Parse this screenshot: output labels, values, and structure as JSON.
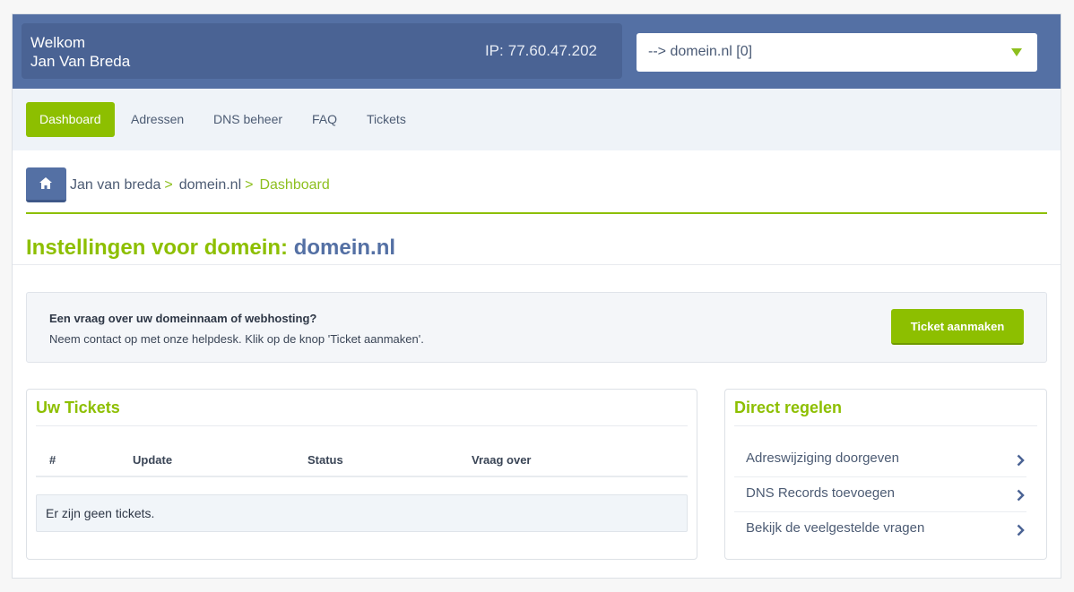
{
  "header": {
    "welcome": "Welkom",
    "user_name": "Jan Van Breda",
    "ip_label": "IP:",
    "ip_value": "77.60.47.202",
    "domain_select": "--> domein.nl [0]"
  },
  "nav": {
    "items": [
      {
        "label": "Dashboard",
        "active": true
      },
      {
        "label": "Adressen"
      },
      {
        "label": "DNS beheer"
      },
      {
        "label": "FAQ"
      },
      {
        "label": "Tickets"
      }
    ]
  },
  "breadcrumb": {
    "home_icon": "home-icon",
    "items": [
      "Jan van breda",
      "domein.nl"
    ],
    "separator": ">",
    "current": "Dashboard"
  },
  "page": {
    "title_prefix": "Instellingen voor domein:",
    "title_domain": "domein.nl"
  },
  "help": {
    "question": "Een vraag over uw domeinnaam of webhosting?",
    "text": "Neem contact op met onze helpdesk. Klik op de knop 'Ticket aanmaken'.",
    "button": "Ticket aanmaken"
  },
  "tickets": {
    "title": "Uw Tickets",
    "columns": [
      "#",
      "Update",
      "Status",
      "Vraag over"
    ],
    "empty": "Er zijn geen tickets."
  },
  "direct": {
    "title": "Direct regelen",
    "items": [
      "Adreswijziging doorgeven",
      "DNS Records toevoegen",
      "Bekijk de veelgestelde vragen"
    ]
  },
  "colors": {
    "accent_green": "#8dbf00",
    "header_blue": "#5470a4"
  }
}
